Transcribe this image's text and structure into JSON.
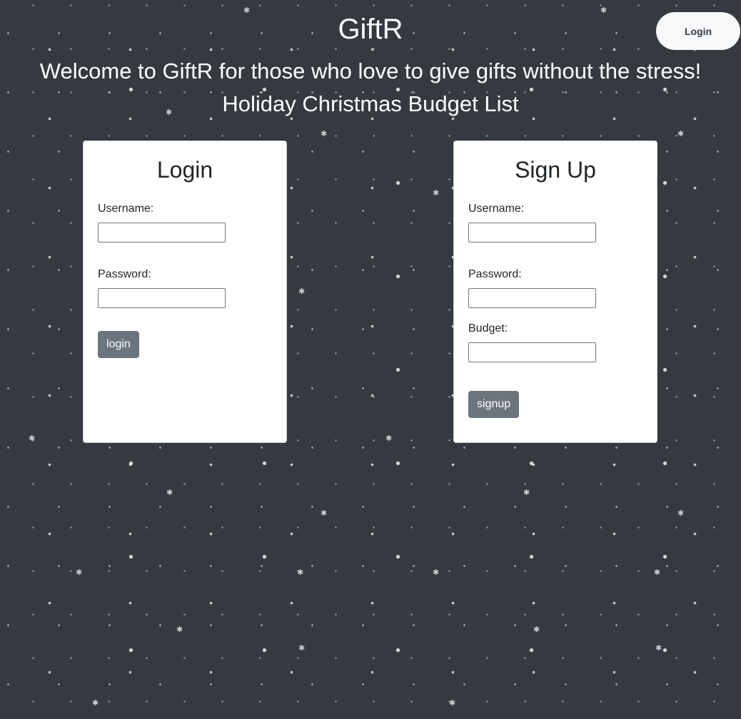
{
  "header": {
    "title": "GiftR",
    "login_button": "Login"
  },
  "welcome": "Welcome to GiftR for those who love to give gifts without the stress!",
  "subtitle": "Holiday Christmas Budget List",
  "login_form": {
    "title": "Login",
    "username_label": "Username:",
    "username_value": "",
    "password_label": "Password:",
    "password_value": "",
    "submit_label": "login"
  },
  "signup_form": {
    "title": "Sign Up",
    "username_label": "Username:",
    "username_value": "",
    "password_label": "Password:",
    "password_value": "",
    "budget_label": "Budget:",
    "budget_value": "",
    "submit_label": "signup"
  },
  "colors": {
    "background": "#343a40",
    "card": "#ffffff",
    "button": "#6c757d",
    "header_button": "#f8f9fa"
  }
}
